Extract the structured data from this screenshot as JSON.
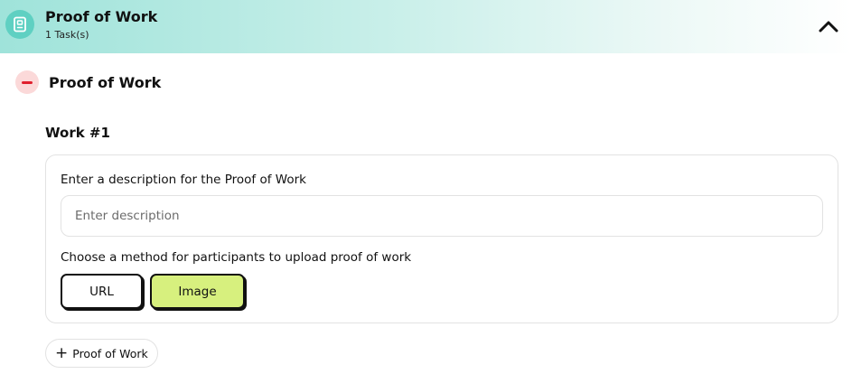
{
  "header": {
    "title": "Proof of Work",
    "subtitle": "1 Task(s)",
    "icon": "document-icon",
    "collapse_icon": "chevron-up-icon"
  },
  "section": {
    "title": "Proof of Work",
    "remove_icon": "minus-icon"
  },
  "work": {
    "title": "Work #1",
    "description_label": "Enter a description for the Proof of Work",
    "description_placeholder": "Enter description",
    "description_value": "",
    "method_label": "Choose a method for participants to upload proof of work",
    "methods": [
      {
        "label": "URL",
        "selected": false
      },
      {
        "label": "Image",
        "selected": true
      }
    ]
  },
  "add_button": {
    "label": "Proof of Work",
    "icon": "plus-icon"
  },
  "colors": {
    "header_accent": "#5fd0c2",
    "selected_method": "#d7f07e",
    "remove_bg": "#fbd9d9",
    "remove_fg": "#e0202e"
  }
}
